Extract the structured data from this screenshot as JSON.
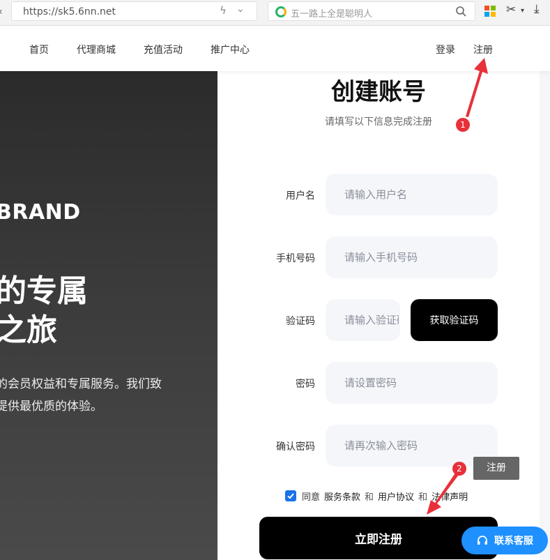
{
  "browser": {
    "url": "https://sk5.6nn.net",
    "search_placeholder": "五一路上全是聪明人"
  },
  "nav": {
    "items": [
      {
        "label": "首页"
      },
      {
        "label": "代理商城"
      },
      {
        "label": "充值活动"
      },
      {
        "label": "推广中心"
      }
    ],
    "login": "登录",
    "register": "注册"
  },
  "hero": {
    "brand": "BRAND",
    "title_line1": "的专属",
    "title_line2": "之旅",
    "desc_line1": "的会员权益和专属服务。我们致",
    "desc_line2": "提供最优质的体验。"
  },
  "form": {
    "title": "创建账号",
    "subtitle": "请填写以下信息完成注册",
    "fields": [
      {
        "label": "用户名",
        "placeholder": "请输入用户名"
      },
      {
        "label": "手机号码",
        "placeholder": "请输入手机号码"
      },
      {
        "label": "验证码",
        "placeholder": "请输入验证码"
      },
      {
        "label": "密码",
        "placeholder": "请设置密码"
      },
      {
        "label": "确认密码",
        "placeholder": "请再次输入密码"
      }
    ],
    "get_code": "获取验证码",
    "agree": {
      "prefix": "同意",
      "terms": "服务条款",
      "and1": "和",
      "user_agreement": "用户协议",
      "and2": "和",
      "legal": "法律声明"
    },
    "submit": "立即注册"
  },
  "annotations": {
    "tooltip": "注册",
    "marker1": "1",
    "marker2": "2"
  },
  "support": {
    "label": "联系客服"
  },
  "colors": {
    "accent": "#1a73e8",
    "marker": "#e8303a",
    "support": "#1e90ff"
  }
}
